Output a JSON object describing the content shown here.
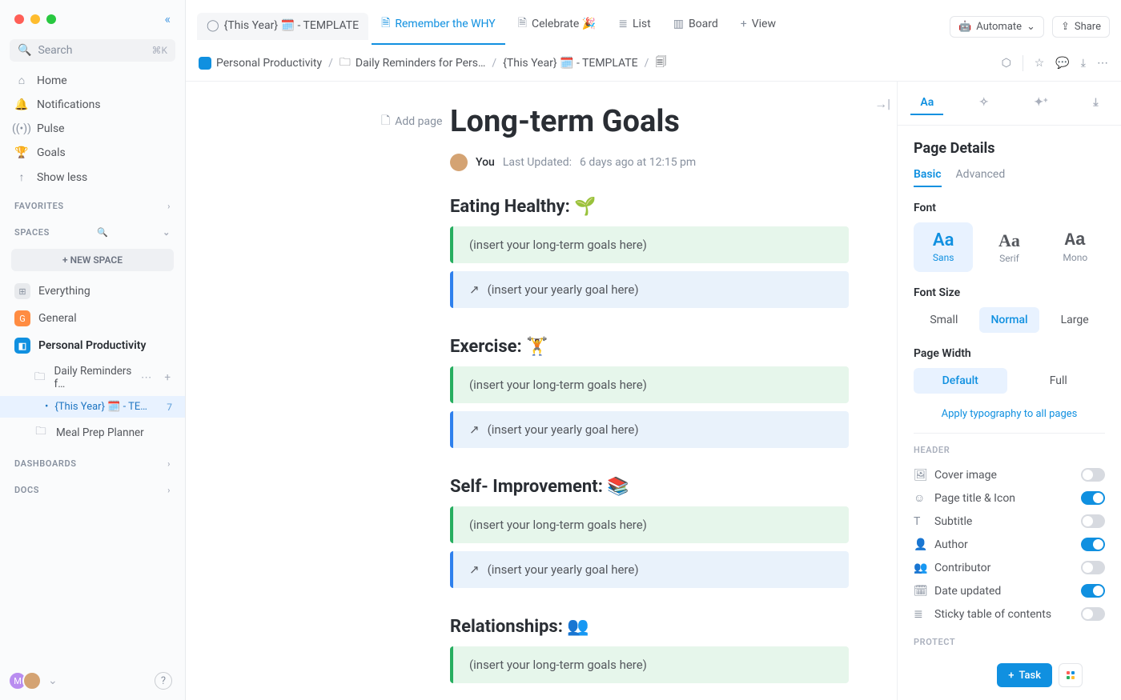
{
  "search": {
    "placeholder": "Search",
    "shortcut": "⌘K"
  },
  "nav": {
    "home": "Home",
    "notifications": "Notifications",
    "pulse": "Pulse",
    "goals": "Goals",
    "show_less": "Show less"
  },
  "sections": {
    "favorites": "FAVORITES",
    "spaces": "SPACES",
    "dashboards": "DASHBOARDS",
    "docs": "DOCS"
  },
  "new_space": "+  NEW SPACE",
  "spaces": {
    "everything": "Everything",
    "general": "General",
    "personal": "Personal Productivity"
  },
  "tree": {
    "folder": "Daily Reminders f…",
    "item_active": "{This Year} 🗓️ - TE…",
    "item_active_count": "7",
    "meal": "Meal Prep Planner"
  },
  "tabs": {
    "t0": "{This Year} 🗓️ - TEMPLATE",
    "t1": "Remember the WHY",
    "t2": "Celebrate 🎉",
    "t3": "List",
    "t4": "Board",
    "t5": "View"
  },
  "topbar": {
    "automate": "Automate",
    "share": "Share"
  },
  "breadcrumb": {
    "b0": "Personal Productivity",
    "b1": "Daily Reminders for Pers…",
    "b2": "{This Year} 🗓️ - TEMPLATE"
  },
  "add_page": "Add page",
  "page": {
    "title": "Long-term Goals",
    "you": "You",
    "updated_label": "Last Updated:",
    "updated_val": "6 days ago at 12:15 pm"
  },
  "sec": {
    "eat": "Eating Healthy: 🌱",
    "ex": "Exercise: 🏋️",
    "self": "Self- Improvement: 📚",
    "rel": "Relationships: 👥"
  },
  "ph": {
    "long": "(insert your long-term goals here)",
    "year": "(insert your yearly goal here)"
  },
  "rpanel": {
    "aa": "Aa",
    "title": "Page Details",
    "basic": "Basic",
    "advanced": "Advanced",
    "font": "Font",
    "sans": "Sans",
    "serif": "Serif",
    "mono": "Mono",
    "font_size": "Font Size",
    "small": "Small",
    "normal": "Normal",
    "large": "Large",
    "page_width": "Page Width",
    "default": "Default",
    "full": "Full",
    "apply": "Apply typography to all pages",
    "header": "HEADER",
    "cover": "Cover image",
    "title_icon": "Page title & Icon",
    "subtitle": "Subtitle",
    "author": "Author",
    "contributor": "Contributor",
    "date_updated": "Date updated",
    "sticky_toc": "Sticky table of contents",
    "protect": "PROTECT"
  },
  "task_btn": "Task"
}
